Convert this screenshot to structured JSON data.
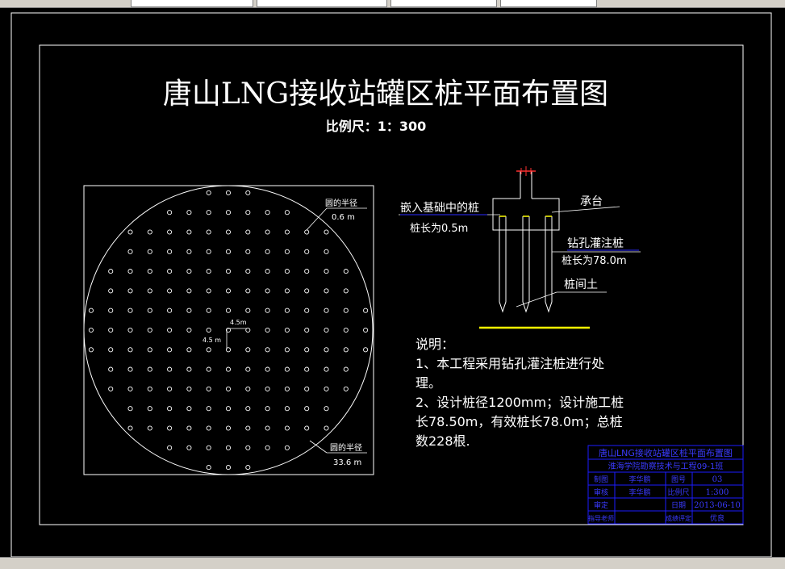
{
  "drawing": {
    "title": "唐山LNG接收站罐区桩平面布置图",
    "scale": "比例尺：1：300",
    "plan": {
      "radius_small_label": "圆的半径",
      "radius_small_value": "0.6 m",
      "radius_large_label": "圆的半径",
      "radius_large_value": "33.6 m",
      "spacing_h": "4.5m",
      "spacing_v": "4.5 m"
    },
    "section": {
      "embedded_pile": "嵌入基础中的桩",
      "embedded_length": "桩长为0.5m",
      "cap": "承台",
      "bored_pile": "钻孔灌注桩",
      "bored_length": "桩长为78.0m",
      "soil": "桩间土"
    },
    "notes": {
      "heading": "说明：",
      "line1": "1、本工程采用钻孔灌注桩进行处",
      "line2": "理。",
      "line3": "2、设计桩径1200mm；设计施工桩",
      "line4": "长78.50m，有效桩长78.0m；总桩",
      "line5": "数228根."
    },
    "title_block": {
      "project": "唐山LNG接收站罐区桩平面布置图",
      "subtitle": "淮海学院勘察技术与工程09-1班",
      "r1c1": "制图",
      "r1c2": "李华鹏",
      "r1c3": "图号",
      "r1c4": "03",
      "r2c1": "审核",
      "r2c2": "李华鹏",
      "r2c3": "比例尺",
      "r2c4": "1:300",
      "r3c1": "审定",
      "r3c3": "日期",
      "r3c4": "2013-06-10",
      "r4c1": "指导老师",
      "r4c3": "成绩评定",
      "r4c4": "优良"
    },
    "colors": {
      "line": "#ffffff",
      "accent_yellow": "#ffff00",
      "title_block": "#1c1cff",
      "pile_marker": "#ff3030"
    }
  }
}
